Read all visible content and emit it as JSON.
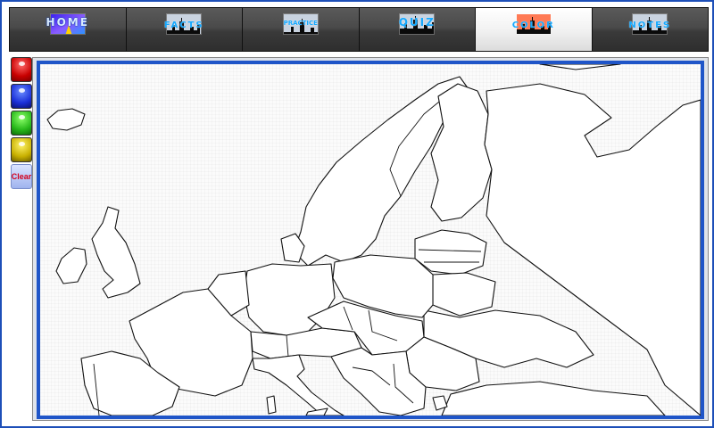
{
  "nav": {
    "tabs": [
      {
        "id": "home",
        "label": "HOME",
        "icon": "home-picture-icon",
        "active": false
      },
      {
        "id": "facts",
        "label": "FACTS",
        "icon": "skyline-icon",
        "active": false
      },
      {
        "id": "practice",
        "label": "PRACTICE",
        "icon": "skyline-icon",
        "active": false
      },
      {
        "id": "quiz",
        "label": "QUIZ",
        "icon": "skyline-icon",
        "active": false
      },
      {
        "id": "color",
        "label": "COLOR",
        "icon": "skyline-icon",
        "active": true
      },
      {
        "id": "notes",
        "label": "NOTES",
        "icon": "skyline-icon",
        "active": false
      }
    ]
  },
  "palette": {
    "colors": [
      {
        "name": "red",
        "hex": "#c80000"
      },
      {
        "name": "blue",
        "hex": "#1a2fd8"
      },
      {
        "name": "green",
        "hex": "#27b81a"
      },
      {
        "name": "yellow",
        "hex": "#c8b000"
      }
    ],
    "clear_label": "Clear"
  },
  "map": {
    "subject": "europe-outline-map",
    "border_color": "#1f55c8"
  }
}
